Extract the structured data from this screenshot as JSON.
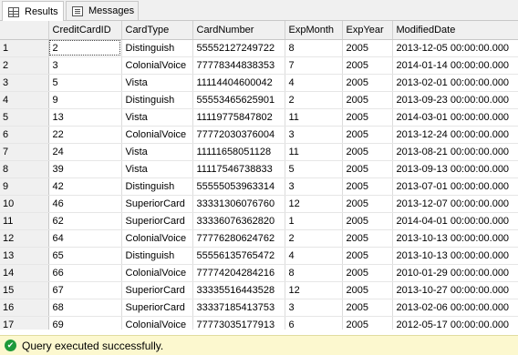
{
  "tabs": [
    {
      "label": "Results",
      "icon": "grid-icon"
    },
    {
      "label": "Messages",
      "icon": "messages-icon"
    }
  ],
  "columns": [
    "CreditCardID",
    "CardType",
    "CardNumber",
    "ExpMonth",
    "ExpYear",
    "ModifiedDate"
  ],
  "rows": [
    {
      "n": "1",
      "id": "2",
      "type": "Distinguish",
      "num": "55552127249722",
      "mon": "8",
      "yr": "2005",
      "date": "2013-12-05 00:00:00.000"
    },
    {
      "n": "2",
      "id": "3",
      "type": "ColonialVoice",
      "num": "77778344838353",
      "mon": "7",
      "yr": "2005",
      "date": "2014-01-14 00:00:00.000"
    },
    {
      "n": "3",
      "id": "5",
      "type": "Vista",
      "num": "11114404600042",
      "mon": "4",
      "yr": "2005",
      "date": "2013-02-01 00:00:00.000"
    },
    {
      "n": "4",
      "id": "9",
      "type": "Distinguish",
      "num": "55553465625901",
      "mon": "2",
      "yr": "2005",
      "date": "2013-09-23 00:00:00.000"
    },
    {
      "n": "5",
      "id": "13",
      "type": "Vista",
      "num": "11119775847802",
      "mon": "11",
      "yr": "2005",
      "date": "2014-03-01 00:00:00.000"
    },
    {
      "n": "6",
      "id": "22",
      "type": "ColonialVoice",
      "num": "77772030376004",
      "mon": "3",
      "yr": "2005",
      "date": "2013-12-24 00:00:00.000"
    },
    {
      "n": "7",
      "id": "24",
      "type": "Vista",
      "num": "11111658051128",
      "mon": "11",
      "yr": "2005",
      "date": "2013-08-21 00:00:00.000"
    },
    {
      "n": "8",
      "id": "39",
      "type": "Vista",
      "num": "11117546738833",
      "mon": "5",
      "yr": "2005",
      "date": "2013-09-13 00:00:00.000"
    },
    {
      "n": "9",
      "id": "42",
      "type": "Distinguish",
      "num": "55555053963314",
      "mon": "3",
      "yr": "2005",
      "date": "2013-07-01 00:00:00.000"
    },
    {
      "n": "10",
      "id": "46",
      "type": "SuperiorCard",
      "num": "33331306076760",
      "mon": "12",
      "yr": "2005",
      "date": "2013-12-07 00:00:00.000"
    },
    {
      "n": "11",
      "id": "62",
      "type": "SuperiorCard",
      "num": "33336076362820",
      "mon": "1",
      "yr": "2005",
      "date": "2014-04-01 00:00:00.000"
    },
    {
      "n": "12",
      "id": "64",
      "type": "ColonialVoice",
      "num": "77776280624762",
      "mon": "2",
      "yr": "2005",
      "date": "2013-10-13 00:00:00.000"
    },
    {
      "n": "13",
      "id": "65",
      "type": "Distinguish",
      "num": "55556135765472",
      "mon": "4",
      "yr": "2005",
      "date": "2013-10-13 00:00:00.000"
    },
    {
      "n": "14",
      "id": "66",
      "type": "ColonialVoice",
      "num": "77774204284216",
      "mon": "8",
      "yr": "2005",
      "date": "2010-01-29 00:00:00.000"
    },
    {
      "n": "15",
      "id": "67",
      "type": "SuperiorCard",
      "num": "33335516443528",
      "mon": "12",
      "yr": "2005",
      "date": "2013-10-27 00:00:00.000"
    },
    {
      "n": "16",
      "id": "68",
      "type": "SuperiorCard",
      "num": "33337185413753",
      "mon": "3",
      "yr": "2005",
      "date": "2013-02-06 00:00:00.000"
    },
    {
      "n": "17",
      "id": "69",
      "type": "ColonialVoice",
      "num": "77773035177913",
      "mon": "6",
      "yr": "2005",
      "date": "2012-05-17 00:00:00.000"
    }
  ],
  "status": {
    "text": "Query executed successfully.",
    "icon": "check-icon",
    "color": "#1e9a3a",
    "background": "#fcf8cf"
  }
}
